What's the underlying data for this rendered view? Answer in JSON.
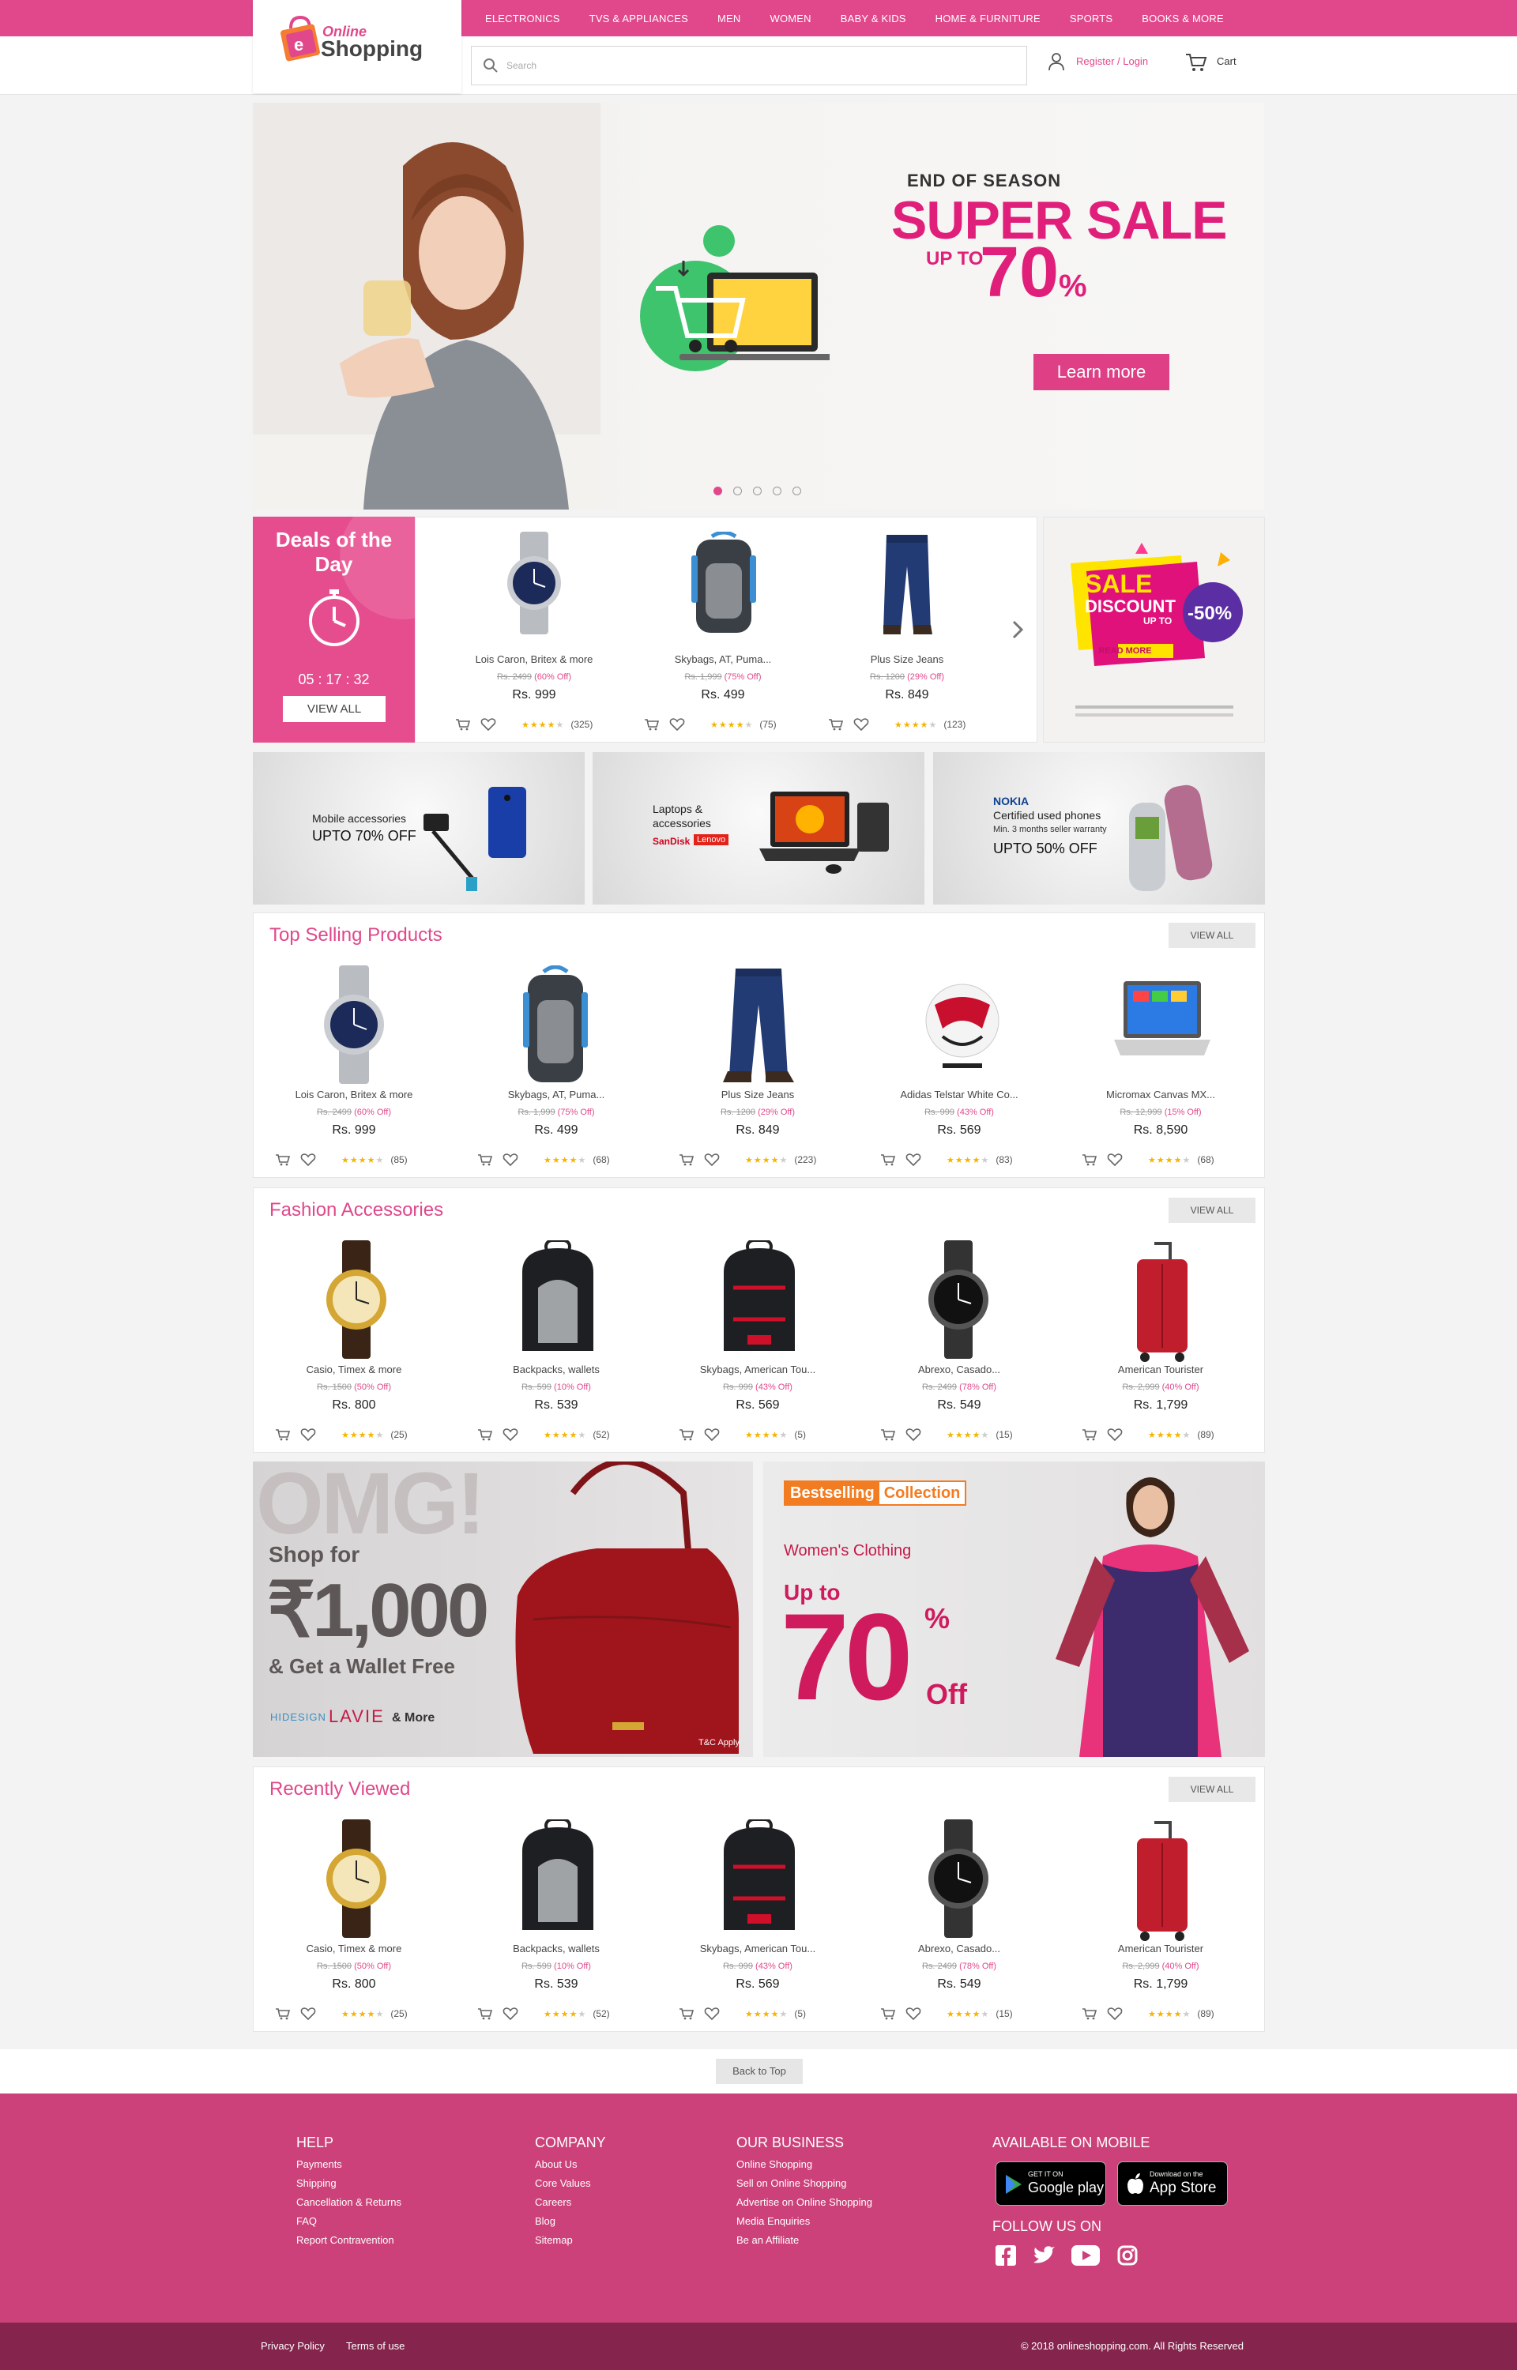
{
  "brand": {
    "line1": "Online",
    "line2": "Shopping"
  },
  "nav": [
    "ELECTRONICS",
    "TVS & APPLIANCES",
    "MEN",
    "WOMEN",
    "BABY & KIDS",
    "HOME & FURNITURE",
    "SPORTS",
    "BOOKS & MORE"
  ],
  "search": {
    "placeholder": "Search"
  },
  "account": {
    "login": "Register / Login",
    "cart": "Cart"
  },
  "hero": {
    "kicker": "END OF SEASON",
    "headline": "SUPER SALE",
    "upto": "UP TO",
    "percent": "70",
    "percent_sign": "%",
    "cta": "Learn more"
  },
  "deals": {
    "title": "Deals of the Day",
    "timer": "05 : 17 : 32",
    "view_all": "VIEW ALL",
    "items": [
      {
        "name": "Lois Caron, Britex & more",
        "old": "Rs. 2499",
        "off": "(60% Off)",
        "price": "Rs. 999",
        "reviews": "(325)"
      },
      {
        "name": "Skybags, AT, Puma...",
        "old": "Rs. 1,999",
        "off": "(75% Off)",
        "price": "Rs. 499",
        "reviews": "(75)"
      },
      {
        "name": "Plus Size Jeans",
        "old": "Rs. 1200",
        "off": "(29% Off)",
        "price": "Rs. 849",
        "reviews": "(123)"
      }
    ]
  },
  "sale_ad": {
    "sale": "SALE",
    "discount": "DISCOUNT",
    "upto": "UP TO",
    "percent": "-50%",
    "cta": "READ MORE"
  },
  "promos": [
    {
      "line1": "Mobile accessories",
      "line2": "UPTO 70% OFF"
    },
    {
      "line1": "Laptops &",
      "line2": "accessories",
      "brand1": "SanDisk",
      "brand2": "Lenovo"
    },
    {
      "brand": "NOKIA",
      "line1": "Certified used phones",
      "line2": "Min. 3 months seller warranty",
      "line3": "UPTO 50% OFF"
    }
  ],
  "top_selling": {
    "title": "Top Selling Products",
    "view_all": "VIEW ALL",
    "items": [
      {
        "name": "Lois Caron, Britex & more",
        "old": "Rs. 2499",
        "off": "(60% Off)",
        "price": "Rs. 999",
        "reviews": "(85)"
      },
      {
        "name": "Skybags, AT, Puma...",
        "old": "Rs. 1,999",
        "off": "(75% Off)",
        "price": "Rs. 499",
        "reviews": "(68)"
      },
      {
        "name": "Plus Size Jeans",
        "old": "Rs. 1200",
        "off": "(29% Off)",
        "price": "Rs. 849",
        "reviews": "(223)"
      },
      {
        "name": "Adidas Telstar White Co...",
        "old": "Rs. 999",
        "off": "(43% Off)",
        "price": "Rs. 569",
        "reviews": "(83)"
      },
      {
        "name": "Micromax Canvas MX...",
        "old": "Rs. 12,999",
        "off": "(15% Off)",
        "price": "Rs. 8,590",
        "reviews": "(68)"
      }
    ]
  },
  "fashion": {
    "title": "Fashion Accessories",
    "view_all": "VIEW ALL",
    "items": [
      {
        "name": "Casio, Timex & more",
        "old": "Rs. 1500",
        "off": "(50% Off)",
        "price": "Rs. 800",
        "reviews": "(25)"
      },
      {
        "name": "Backpacks, wallets",
        "old": "Rs. 599",
        "off": "(10% Off)",
        "price": "Rs. 539",
        "reviews": "(52)"
      },
      {
        "name": "Skybags, American Tou...",
        "old": "Rs. 999",
        "off": "(43% Off)",
        "price": "Rs. 569",
        "reviews": "(5)"
      },
      {
        "name": "Abrexo, Casado...",
        "old": "Rs. 2499",
        "off": "(78% Off)",
        "price": "Rs. 549",
        "reviews": "(15)"
      },
      {
        "name": "American Tourister",
        "old": "Rs. 2,999",
        "off": "(40% Off)",
        "price": "Rs. 1,799",
        "reviews": "(89)"
      }
    ]
  },
  "banner_left": {
    "omg": "OMG!",
    "line1": "Shop for",
    "amount": "₹1,000",
    "line2": "& Get a Wallet Free",
    "brand1": "HIDESIGN",
    "brand2": "LAVIE",
    "more": "& More",
    "tc": "T&C Apply"
  },
  "banner_right": {
    "tag1": "Bestselling",
    "tag2": "Collection",
    "sub": "Women's Clothing",
    "upto": "Up to",
    "big": "70",
    "pct": "%",
    "off": "Off"
  },
  "recent": {
    "title": "Recently Viewed",
    "view_all": "VIEW ALL",
    "items": [
      {
        "name": "Casio, Timex & more",
        "old": "Rs. 1500",
        "off": "(50% Off)",
        "price": "Rs. 800",
        "reviews": "(25)"
      },
      {
        "name": "Backpacks, wallets",
        "old": "Rs. 599",
        "off": "(10% Off)",
        "price": "Rs. 539",
        "reviews": "(52)"
      },
      {
        "name": "Skybags, American Tou...",
        "old": "Rs. 999",
        "off": "(43% Off)",
        "price": "Rs. 569",
        "reviews": "(5)"
      },
      {
        "name": "Abrexo, Casado...",
        "old": "Rs. 2499",
        "off": "(78% Off)",
        "price": "Rs. 549",
        "reviews": "(15)"
      },
      {
        "name": "American Tourister",
        "old": "Rs. 2,999",
        "off": "(40% Off)",
        "price": "Rs. 1,799",
        "reviews": "(89)"
      }
    ]
  },
  "back_to_top": "Back to Top",
  "footer": {
    "help": {
      "title": "HELP",
      "links": [
        "Payments",
        "Shipping",
        "Cancellation & Returns",
        "FAQ",
        "Report Contravention"
      ]
    },
    "company": {
      "title": "COMPANY",
      "links": [
        "About Us",
        "Core Values",
        "Careers",
        "Blog",
        "Sitemap"
      ]
    },
    "business": {
      "title": "OUR BUSINESS",
      "links": [
        "Online Shopping",
        "Sell on Online Shopping",
        "Advertise on Online Shopping",
        "Media Enquiries",
        "Be an Affiliate"
      ]
    },
    "mobile": {
      "title": "AVAILABLE ON MOBILE",
      "gp_small": "GET IT ON",
      "gp_big": "Google play",
      "as_small": "Download on the",
      "as_big": "App Store"
    },
    "follow": "FOLLOW US ON",
    "privacy": "Privacy Policy",
    "terms": "Terms of use",
    "copyright": "© 2018 onlineshopping.com. All Rights Reserved"
  },
  "colors": {
    "accent": "#e0488b",
    "footer": "#cc4179",
    "footer_bottom": "#85254e"
  },
  "icons": [
    "search-icon",
    "user-icon",
    "cart-icon",
    "clock-icon",
    "chevron-right-icon",
    "heart-icon",
    "star-icon",
    "facebook-icon",
    "twitter-icon",
    "youtube-icon",
    "instagram-icon",
    "google-play-icon",
    "apple-icon"
  ]
}
